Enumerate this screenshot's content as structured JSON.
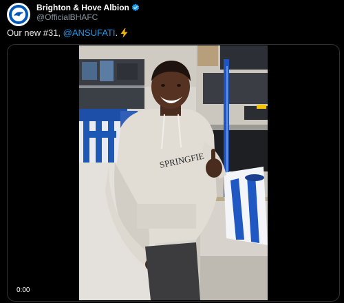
{
  "tweet": {
    "author_name": "Brighton & Hove Albion",
    "author_handle": "@OfficialBHAFC",
    "text_before": "Our new #31, ",
    "mention": "@ANSUFATI",
    "text_after": ".",
    "emoji_icon": "lightning-bolt-icon",
    "avatar_icon": "club-crest-icon"
  },
  "video": {
    "time": "0:00",
    "description_icon": "video-thumbnail"
  },
  "colors": {
    "background": "#000000",
    "text": "#e7e9ea",
    "muted": "#8b98a5",
    "link": "#1d9bf0",
    "verified": "#1d9bf0",
    "brand_blue": "#0057b8"
  }
}
